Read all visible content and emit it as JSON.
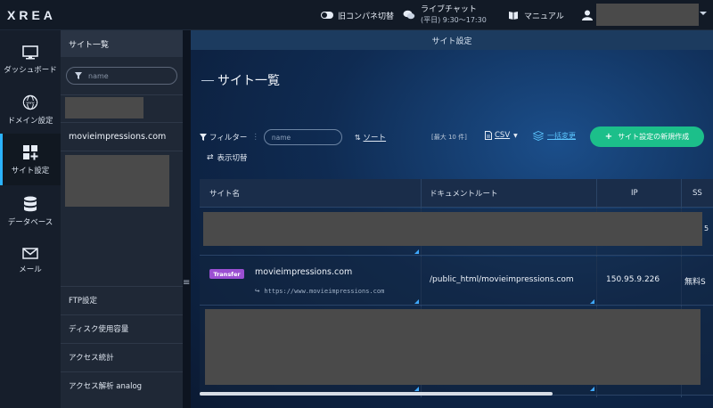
{
  "topbar": {
    "logo": "XREA",
    "legacy_panel_label": "旧コンパネ切替",
    "chat_label": "ライブチャット",
    "chat_hours": "(平日) 9:30～17:30",
    "manual_label": "マニュアル"
  },
  "leftnav": {
    "items": [
      {
        "label": "ダッシュボード",
        "icon": "monitor-icon"
      },
      {
        "label": "ドメイン設定",
        "icon": "globe-www-icon"
      },
      {
        "label": "サイト設定",
        "icon": "grid-plus-icon",
        "active": true
      },
      {
        "label": "データベース",
        "icon": "database-icon"
      },
      {
        "label": "メール",
        "icon": "envelope-icon"
      }
    ]
  },
  "subnav": {
    "title": "サイト一覧",
    "search_placeholder": "name",
    "site_item": "movieimpressions.com",
    "footer_items": [
      "FTP設定",
      "ディスク使用容量",
      "アクセス統計",
      "アクセス解析 analog"
    ]
  },
  "main": {
    "header": "サイト設定",
    "title": "サイト一覧",
    "filter_label": "フィルター",
    "filter_placeholder": "name",
    "sort_label": "ソート",
    "max_label": "[最大 10 件]",
    "csv_label": "CSV",
    "bulk_label": "一括変更",
    "create_button": "サイト設定の新規作成",
    "display_switch": "表示切替",
    "table": {
      "columns": [
        "サイト名",
        "ドキュメントルート",
        "IP",
        "SS"
      ],
      "row": {
        "badge": "Transfer",
        "site_name": "movieimpressions.com",
        "site_url": "https://www.movieimpressions.com",
        "doc_root": "/public_html/movieimpressions.com",
        "ip": "150.95.9.226",
        "ssl": "無料S"
      },
      "masked_row_marker": "5"
    }
  },
  "colors": {
    "accent": "#2bb3ff",
    "create_button": "#1cbf8a",
    "badge": "#9b4fd2",
    "link": "#5cc6ff"
  }
}
